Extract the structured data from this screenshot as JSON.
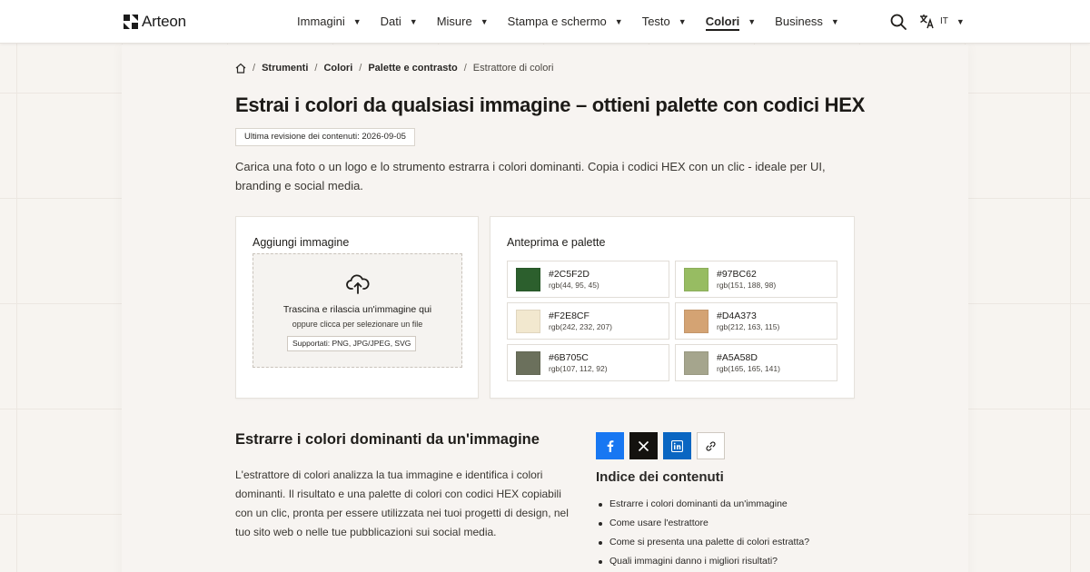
{
  "header": {
    "logo_text": "Arteon",
    "nav": [
      {
        "label": "Immagini",
        "active": false
      },
      {
        "label": "Dati",
        "active": false
      },
      {
        "label": "Misure",
        "active": false
      },
      {
        "label": "Stampa e schermo",
        "active": false
      },
      {
        "label": "Testo",
        "active": false
      },
      {
        "label": "Colori",
        "active": true
      },
      {
        "label": "Business",
        "active": false
      }
    ],
    "lang_code": "IT",
    "icons": {
      "search": "search-icon",
      "language": "translate-icon",
      "dropdown": "caret-down-icon"
    }
  },
  "breadcrumb": {
    "items": [
      "Strumenti",
      "Colori",
      "Palette e contrasto"
    ],
    "current": "Estrattore di colori"
  },
  "page": {
    "title": "Estrai i colori da qualsiasi immagine – ottieni palette con codici HEX",
    "revision": "Ultima revisione dei contenuti: 2026-09-05",
    "intro": "Carica una foto o un logo e lo strumento estrarra i colori dominanti. Copia i codici HEX con un clic - ideale per UI, branding e social media."
  },
  "upload": {
    "title": "Aggiungi immagine",
    "drop_text": "Trascina e rilascia un'immagine qui",
    "click_text": "oppure clicca per selezionare un file",
    "supported": "Supportati: PNG, JPG/JPEG, SVG"
  },
  "preview": {
    "title": "Anteprima e palette",
    "swatches": [
      {
        "hex": "#2C5F2D",
        "rgb": "rgb(44, 95, 45)"
      },
      {
        "hex": "#97BC62",
        "rgb": "rgb(151, 188, 98)"
      },
      {
        "hex": "#F2E8CF",
        "rgb": "rgb(242, 232, 207)"
      },
      {
        "hex": "#D4A373",
        "rgb": "rgb(212, 163, 115)"
      },
      {
        "hex": "#6B705C",
        "rgb": "rgb(107, 112, 92)"
      },
      {
        "hex": "#A5A58D",
        "rgb": "rgb(165, 165, 141)"
      }
    ]
  },
  "section": {
    "title": "Estrarre i colori dominanti da un'immagine",
    "body": "L'estrattore di colori analizza la tua immagine e identifica i colori dominanti. Il risultato e una palette di colori con codici HEX copiabili con un clic, pronta per essere utilizzata nei tuoi progetti di design, nel tuo sito web o nelle tue pubblicazioni sui social media."
  },
  "share": {
    "buttons": [
      {
        "name": "share-facebook-button",
        "icon": "facebook-icon",
        "color": "#1877f2"
      },
      {
        "name": "share-x-button",
        "icon": "x-icon",
        "color": "#14120f"
      },
      {
        "name": "share-linkedin-button",
        "icon": "linkedin-icon",
        "color": "#0a66c2"
      },
      {
        "name": "copy-link-button",
        "icon": "link-icon",
        "color": "#ffffff"
      }
    ]
  },
  "toc": {
    "title": "Indice dei contenuti",
    "items": [
      "Estrarre i colori dominanti da un'immagine",
      "Come usare l'estrattore",
      "Come si presenta una palette di colori estratta?",
      "Quali immagini danno i migliori risultati?"
    ]
  }
}
